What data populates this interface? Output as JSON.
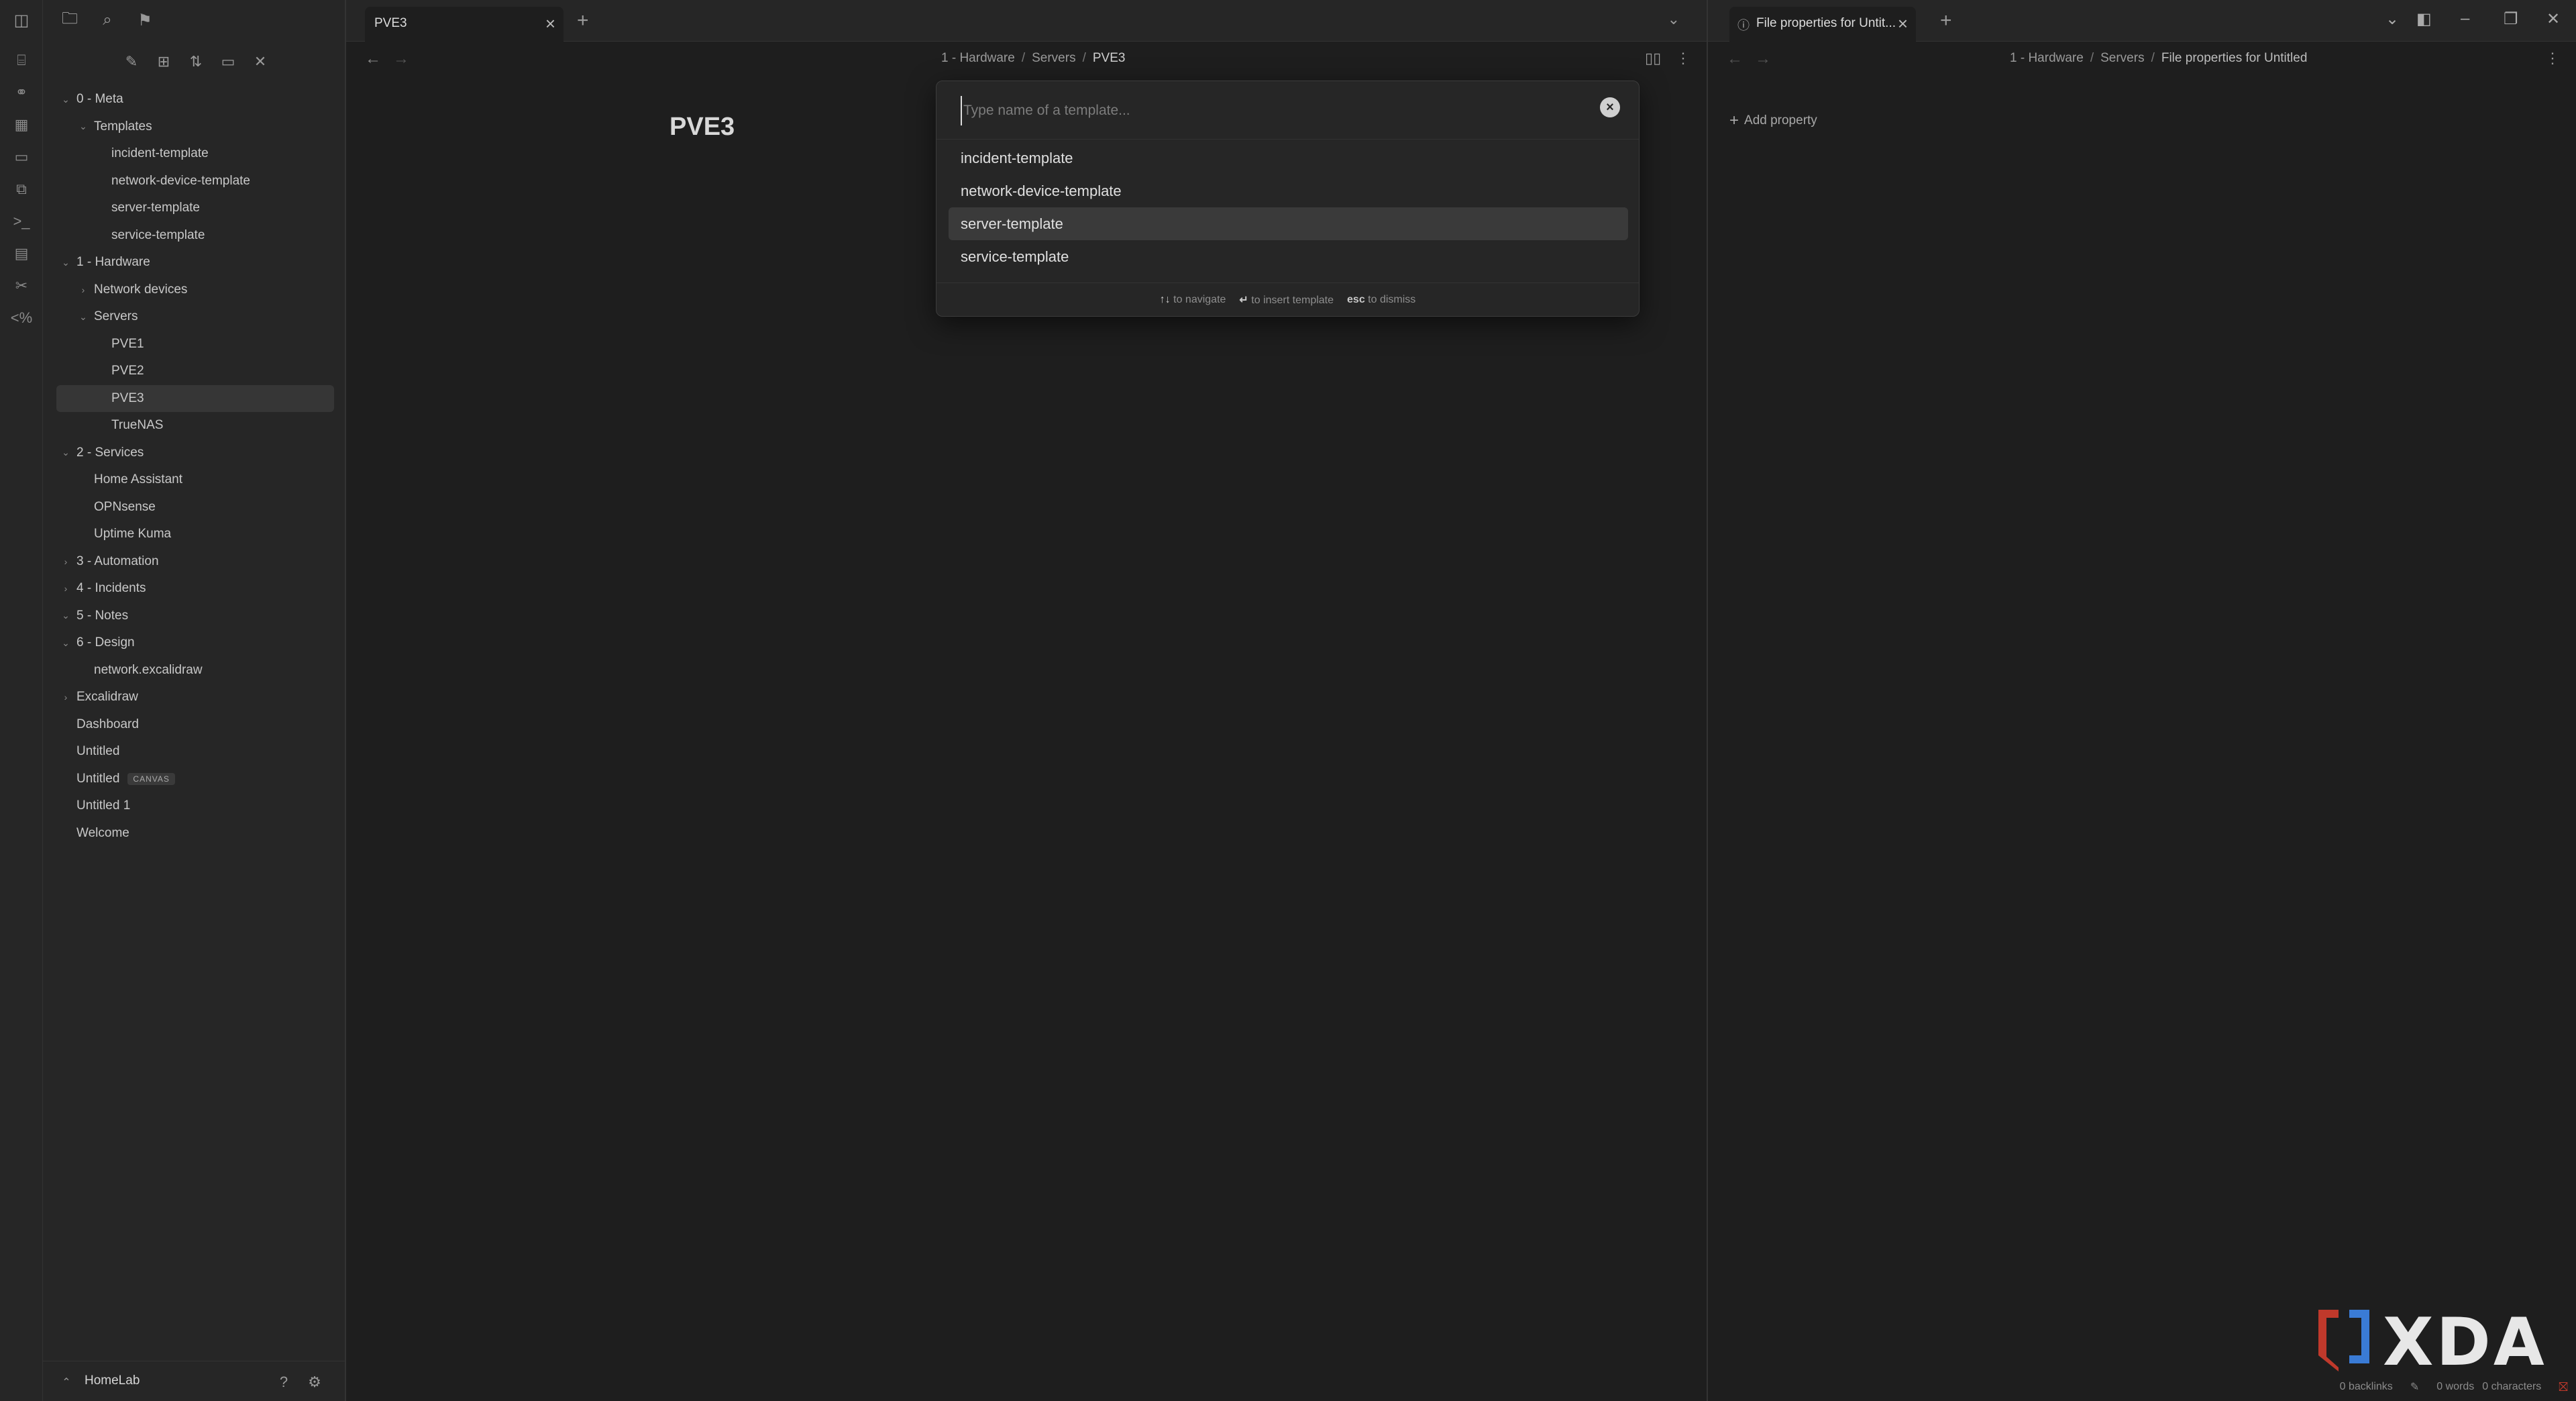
{
  "sidebar": {
    "vault_name": "HomeLab",
    "tree": [
      {
        "label": "0 - Meta",
        "level": 0,
        "expander": "open"
      },
      {
        "label": "Templates",
        "level": 1,
        "expander": "open"
      },
      {
        "label": "incident-template",
        "level": 2,
        "expander": "none"
      },
      {
        "label": "network-device-template",
        "level": 2,
        "expander": "none"
      },
      {
        "label": "server-template",
        "level": 2,
        "expander": "none"
      },
      {
        "label": "service-template",
        "level": 2,
        "expander": "none"
      },
      {
        "label": "1 - Hardware",
        "level": 0,
        "expander": "open"
      },
      {
        "label": "Network devices",
        "level": 1,
        "expander": "closed"
      },
      {
        "label": "Servers",
        "level": 1,
        "expander": "open"
      },
      {
        "label": "PVE1",
        "level": 2,
        "expander": "none"
      },
      {
        "label": "PVE2",
        "level": 2,
        "expander": "none"
      },
      {
        "label": "PVE3",
        "level": 2,
        "expander": "none",
        "active": true
      },
      {
        "label": "TrueNAS",
        "level": 2,
        "expander": "none"
      },
      {
        "label": "2 - Services",
        "level": 0,
        "expander": "open"
      },
      {
        "label": "Home Assistant",
        "level": 1,
        "expander": "none"
      },
      {
        "label": "OPNsense",
        "level": 1,
        "expander": "none"
      },
      {
        "label": "Uptime Kuma",
        "level": 1,
        "expander": "none"
      },
      {
        "label": "3 - Automation",
        "level": 0,
        "expander": "closed"
      },
      {
        "label": "4 - Incidents",
        "level": 0,
        "expander": "closed"
      },
      {
        "label": "5 - Notes",
        "level": 0,
        "expander": "open"
      },
      {
        "label": "6 - Design",
        "level": 0,
        "expander": "open"
      },
      {
        "label": "network.excalidraw",
        "level": 1,
        "expander": "none"
      },
      {
        "label": "Excalidraw",
        "level": 0,
        "expander": "closed"
      },
      {
        "label": "Dashboard",
        "level": 0,
        "expander": "none"
      },
      {
        "label": "Untitled",
        "level": 0,
        "expander": "none"
      },
      {
        "label": "Untitled",
        "level": 0,
        "expander": "none",
        "badge": "CANVAS"
      },
      {
        "label": "Untitled 1",
        "level": 0,
        "expander": "none"
      },
      {
        "label": "Welcome",
        "level": 0,
        "expander": "none"
      }
    ]
  },
  "main": {
    "tab_title": "PVE3",
    "breadcrumb": [
      "1 - Hardware",
      "Servers",
      "PVE3"
    ],
    "note_title": "PVE3"
  },
  "modal": {
    "placeholder": "Type name of a template...",
    "results": [
      {
        "label": "incident-template",
        "selected": false
      },
      {
        "label": "network-device-template",
        "selected": false
      },
      {
        "label": "server-template",
        "selected": true
      },
      {
        "label": "service-template",
        "selected": false
      }
    ],
    "footer": {
      "navigate_key": "↑↓",
      "navigate_text": "to navigate",
      "insert_key": "↵",
      "insert_text": "to insert template",
      "dismiss_key": "esc",
      "dismiss_text": "to dismiss"
    }
  },
  "right": {
    "tab_title": "File properties for Untit...",
    "breadcrumb": [
      "1 - Hardware",
      "Servers",
      "File properties for Untitled"
    ],
    "add_property": "Add property"
  },
  "status": {
    "backlinks": "0 backlinks",
    "words": "0 words",
    "characters": "0 characters"
  },
  "watermark": {
    "text": "XDA",
    "colors": {
      "red": "#c0392b",
      "blue": "#3a7bd5"
    }
  }
}
